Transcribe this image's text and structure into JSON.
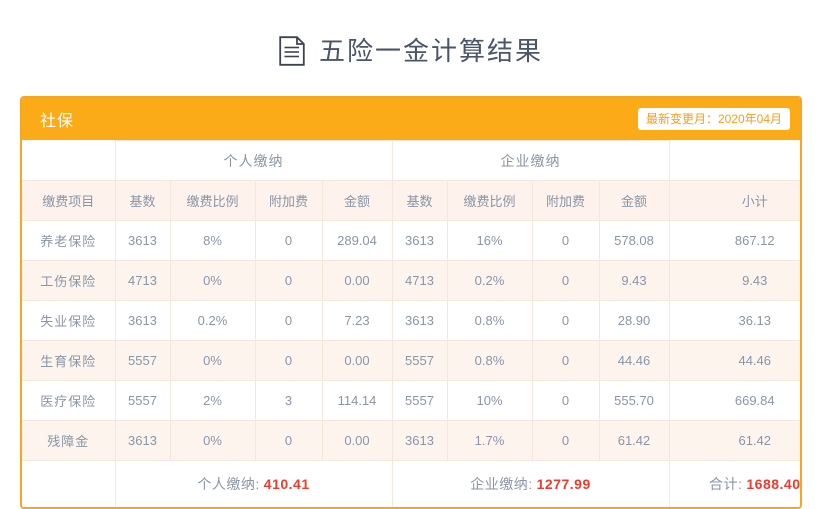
{
  "page": {
    "title": "五险一金计算结果",
    "title_icon": "document-icon"
  },
  "card": {
    "header_title": "社保",
    "badge": "最新变更月：2020年04月",
    "accent_color": "#f5a623",
    "header_bg": "#fbab17",
    "badge_text_color": "#f79c1d",
    "total_color": "#ef3a2e"
  },
  "table": {
    "group_headers": {
      "item": "",
      "personal": "个人缴纳",
      "enterprise": "企业缴纳",
      "subtotal": ""
    },
    "columns": [
      "缴费项目",
      "基数",
      "缴费比例",
      "附加费",
      "金额",
      "基数",
      "缴费比例",
      "附加费",
      "金额",
      "小计"
    ],
    "rows": [
      {
        "item": "养老保险",
        "p_base": "3613",
        "p_rate": "8%",
        "p_add": "0",
        "p_amount": "289.04",
        "e_base": "3613",
        "e_rate": "16%",
        "e_add": "0",
        "e_amount": "578.08",
        "subtotal": "867.12"
      },
      {
        "item": "工伤保险",
        "p_base": "4713",
        "p_rate": "0%",
        "p_add": "0",
        "p_amount": "0.00",
        "e_base": "4713",
        "e_rate": "0.2%",
        "e_add": "0",
        "e_amount": "9.43",
        "subtotal": "9.43"
      },
      {
        "item": "失业保险",
        "p_base": "3613",
        "p_rate": "0.2%",
        "p_add": "0",
        "p_amount": "7.23",
        "e_base": "3613",
        "e_rate": "0.8%",
        "e_add": "0",
        "e_amount": "28.90",
        "subtotal": "36.13"
      },
      {
        "item": "生育保险",
        "p_base": "5557",
        "p_rate": "0%",
        "p_add": "0",
        "p_amount": "0.00",
        "e_base": "5557",
        "e_rate": "0.8%",
        "e_add": "0",
        "e_amount": "44.46",
        "subtotal": "44.46"
      },
      {
        "item": "医疗保险",
        "p_base": "5557",
        "p_rate": "2%",
        "p_add": "3",
        "p_amount": "114.14",
        "e_base": "5557",
        "e_rate": "10%",
        "e_add": "0",
        "e_amount": "555.70",
        "subtotal": "669.84"
      },
      {
        "item": "残障金",
        "p_base": "3613",
        "p_rate": "0%",
        "p_add": "0",
        "p_amount": "0.00",
        "e_base": "3613",
        "e_rate": "1.7%",
        "e_add": "0",
        "e_amount": "61.42",
        "subtotal": "61.42"
      }
    ],
    "totals": {
      "personal_label": "个人缴纳:",
      "personal_value": "410.41",
      "enterprise_label": "企业缴纳:",
      "enterprise_value": "1277.99",
      "grand_label": "合计:",
      "grand_value": "1688.40"
    }
  }
}
